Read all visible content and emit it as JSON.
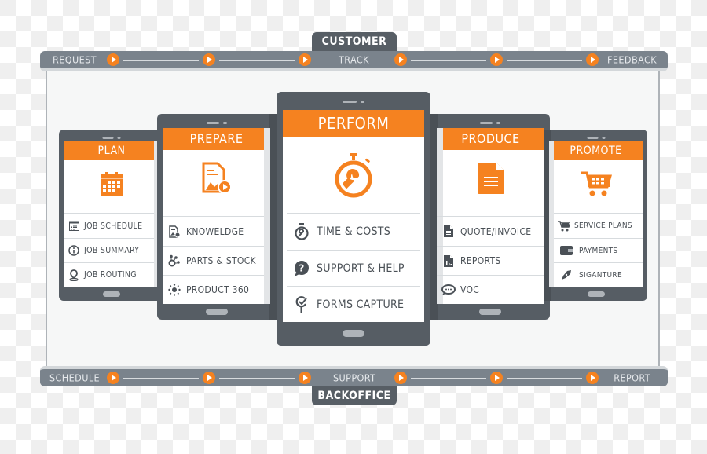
{
  "customer_bar": {
    "tab_label": "CUSTOMER",
    "steps": [
      "REQUEST",
      "TRACK",
      "FEEDBACK"
    ]
  },
  "backoffice_bar": {
    "tab_label": "BACKOFFICE",
    "steps": [
      "SCHEDULE",
      "SUPPORT",
      "REPORT"
    ]
  },
  "colors": {
    "accent": "#f58220",
    "phone_body": "#565d64",
    "bar": "#7a838c",
    "text_dark": "#4a5056"
  },
  "phones": {
    "plan": {
      "title": "PLAN",
      "icon": "calendar-icon",
      "items": [
        {
          "label": "JOB SCHEDULE",
          "icon": "calendar-grid-icon"
        },
        {
          "label": "JOB SUMMARY",
          "icon": "info-icon"
        },
        {
          "label": "JOB ROUTING",
          "icon": "map-pin-icon"
        }
      ]
    },
    "prepare": {
      "title": "PREPARE",
      "icon": "document-media-icon",
      "items": [
        {
          "label": "KNOWELDGE",
          "icon": "document-gear-icon"
        },
        {
          "label": "PARTS & STOCK",
          "icon": "nodes-icon"
        },
        {
          "label": "PRODUCT 360",
          "icon": "sun-dots-icon"
        }
      ]
    },
    "perform": {
      "title": "PERFORM",
      "icon": "stopwatch-wrench-icon",
      "items": [
        {
          "label": "TIME & COSTS",
          "icon": "stopwatch-icon"
        },
        {
          "label": "SUPPORT & HELP",
          "icon": "question-bubble-icon"
        },
        {
          "label": "FORMS CAPTURE",
          "icon": "form-pin-icon"
        }
      ]
    },
    "produce": {
      "title": "PRODUCE",
      "icon": "document-icon",
      "items": [
        {
          "label": "QUOTE/INVOICE",
          "icon": "document-lines-icon"
        },
        {
          "label": "REPORTS",
          "icon": "report-chart-icon"
        },
        {
          "label": "VOC",
          "icon": "chat-bubble-icon"
        }
      ]
    },
    "promote": {
      "title": "PROMOTE",
      "icon": "shopping-cart-icon",
      "items": [
        {
          "label": "SERVICE PLANS",
          "icon": "cart-icon"
        },
        {
          "label": "PAYMENTS",
          "icon": "wallet-icon"
        },
        {
          "label": "SIGANTURE",
          "icon": "pen-nib-icon"
        }
      ]
    }
  }
}
